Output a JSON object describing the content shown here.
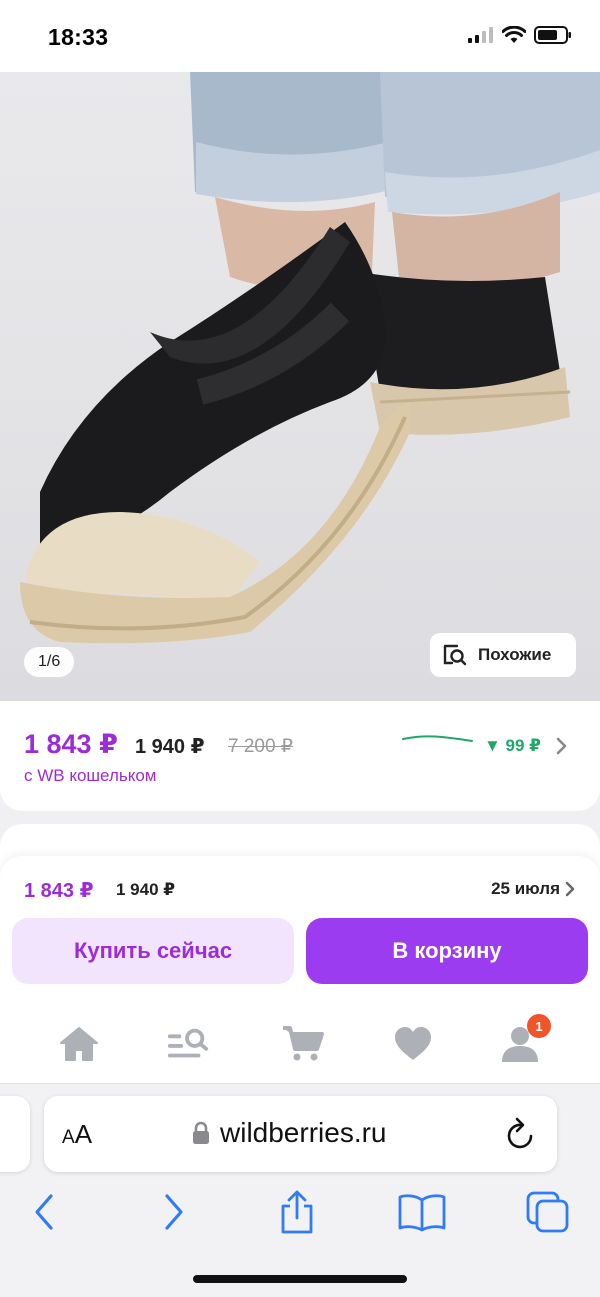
{
  "status_bar": {
    "time": "18:33"
  },
  "gallery": {
    "counter": "1/6",
    "similar_label": "Похожие"
  },
  "price_card": {
    "price": "1 843 ₽",
    "price_without_wallet": "1 940 ₽",
    "old_price": "7 200 ₽",
    "wallet_note": "с WB кошельком",
    "price_drop": "▼ 99 ₽"
  },
  "buy_panel": {
    "price": "1 843 ₽",
    "price_without_wallet": "1 940 ₽",
    "delivery_date": "25 июля",
    "buy_now_label": "Купить сейчас",
    "add_to_cart_label": "В корзину"
  },
  "tab_bar": {
    "items": [
      {
        "icon": "home-icon"
      },
      {
        "icon": "catalog-search-icon"
      },
      {
        "icon": "cart-icon"
      },
      {
        "icon": "heart-icon"
      },
      {
        "icon": "profile-icon"
      }
    ],
    "profile_badge": "1"
  },
  "browser": {
    "aa_small": "A",
    "aa_large": "A",
    "url": "wildberries.ru"
  },
  "colors": {
    "accent_purple": "#9b3cf0",
    "price_purple": "#9b2dd9",
    "price_drop_green": "#1fa86a",
    "badge_orange": "#f0552a"
  }
}
